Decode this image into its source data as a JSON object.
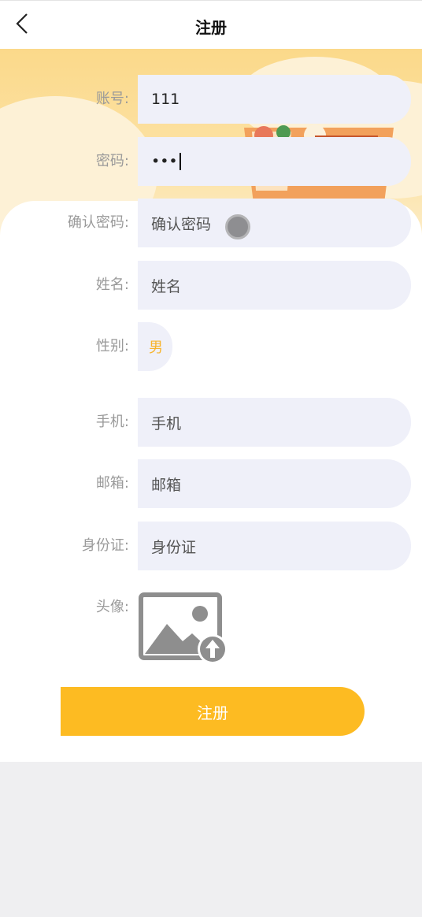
{
  "header": {
    "title": "注册",
    "back_icon": "chevron-left-icon"
  },
  "colors": {
    "accent": "#fdbb22",
    "field_background": "#eff0f9",
    "label_text": "#9a9a9a",
    "gender_text": "#f7b42c",
    "hero_background": "#fbd98a"
  },
  "form": {
    "account": {
      "label": "账号:",
      "value": "111"
    },
    "password": {
      "label": "密码:",
      "value": "•••"
    },
    "confirm_password": {
      "label": "确认密码:",
      "placeholder": "确认密码"
    },
    "name": {
      "label": "姓名:",
      "placeholder": "姓名"
    },
    "gender": {
      "label": "性别:",
      "value": "男"
    },
    "phone": {
      "label": "手机:",
      "placeholder": "手机"
    },
    "email": {
      "label": "邮箱:",
      "placeholder": "邮箱"
    },
    "id_card": {
      "label": "身份证:",
      "placeholder": "身份证"
    },
    "avatar": {
      "label": "头像:",
      "icon": "image-upload-icon"
    }
  },
  "submit_label": "注册"
}
